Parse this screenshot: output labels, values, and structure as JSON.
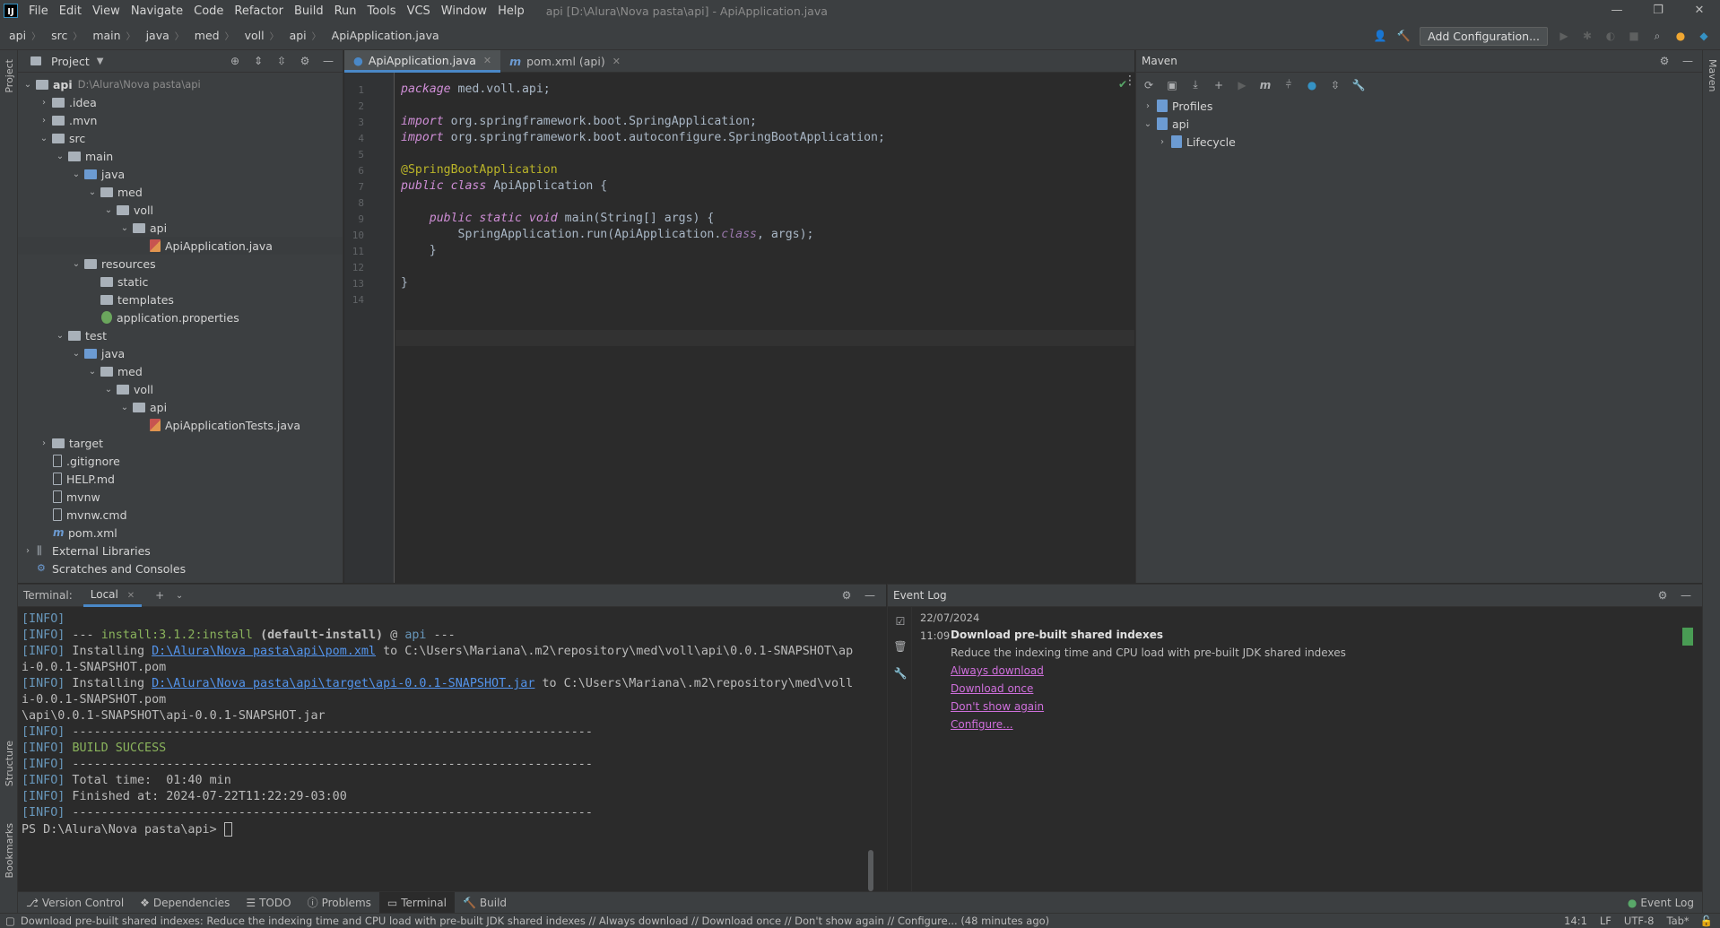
{
  "window": {
    "title": "api [D:\\Alura\\Nova pasta\\api] - ApiApplication.java",
    "controls": [
      "—",
      "❐",
      "✕"
    ]
  },
  "menu": [
    "File",
    "Edit",
    "View",
    "Navigate",
    "Code",
    "Refactor",
    "Build",
    "Run",
    "Tools",
    "VCS",
    "Window",
    "Help"
  ],
  "breadcrumb": [
    "api",
    "src",
    "main",
    "java",
    "med",
    "voll",
    "api",
    "ApiApplication.java"
  ],
  "navbar": {
    "add_config": "Add Configuration..."
  },
  "project": {
    "title": "Project",
    "tree": [
      {
        "depth": 0,
        "arrow": "v",
        "icon": "folder",
        "label": "api",
        "path": "D:\\Alura\\Nova pasta\\api",
        "bold": true
      },
      {
        "depth": 1,
        "arrow": ">",
        "icon": "folder",
        "label": ".idea"
      },
      {
        "depth": 1,
        "arrow": ">",
        "icon": "folder",
        "label": ".mvn"
      },
      {
        "depth": 1,
        "arrow": "v",
        "icon": "folder",
        "label": "src"
      },
      {
        "depth": 2,
        "arrow": "v",
        "icon": "folder",
        "label": "main"
      },
      {
        "depth": 3,
        "arrow": "v",
        "icon": "folder-blue",
        "label": "java"
      },
      {
        "depth": 4,
        "arrow": "v",
        "icon": "folder",
        "label": "med"
      },
      {
        "depth": 5,
        "arrow": "v",
        "icon": "folder",
        "label": "voll"
      },
      {
        "depth": 6,
        "arrow": "v",
        "icon": "folder",
        "label": "api"
      },
      {
        "depth": 7,
        "arrow": "",
        "icon": "java-file",
        "label": "ApiApplication.java",
        "selected": true
      },
      {
        "depth": 3,
        "arrow": "v",
        "icon": "folder",
        "label": "resources"
      },
      {
        "depth": 4,
        "arrow": "",
        "icon": "folder",
        "label": "static"
      },
      {
        "depth": 4,
        "arrow": "",
        "icon": "folder",
        "label": "templates"
      },
      {
        "depth": 4,
        "arrow": "",
        "icon": "properties-file",
        "label": "application.properties"
      },
      {
        "depth": 2,
        "arrow": "v",
        "icon": "folder",
        "label": "test"
      },
      {
        "depth": 3,
        "arrow": "v",
        "icon": "folder-blue",
        "label": "java"
      },
      {
        "depth": 4,
        "arrow": "v",
        "icon": "folder",
        "label": "med"
      },
      {
        "depth": 5,
        "arrow": "v",
        "icon": "folder",
        "label": "voll"
      },
      {
        "depth": 6,
        "arrow": "v",
        "icon": "folder",
        "label": "api"
      },
      {
        "depth": 7,
        "arrow": "",
        "icon": "java-file",
        "label": "ApiApplicationTests.java"
      },
      {
        "depth": 1,
        "arrow": ">",
        "icon": "folder",
        "label": "target"
      },
      {
        "depth": 1,
        "arrow": "",
        "icon": "text-file",
        "label": ".gitignore"
      },
      {
        "depth": 1,
        "arrow": "",
        "icon": "text-file",
        "label": "HELP.md"
      },
      {
        "depth": 1,
        "arrow": "",
        "icon": "text-file",
        "label": "mvnw"
      },
      {
        "depth": 1,
        "arrow": "",
        "icon": "text-file",
        "label": "mvnw.cmd"
      },
      {
        "depth": 1,
        "arrow": "",
        "icon": "maven-file",
        "label": "pom.xml"
      },
      {
        "depth": 0,
        "arrow": ">",
        "icon": "library",
        "label": "External Libraries"
      },
      {
        "depth": 0,
        "arrow": "",
        "icon": "scratch",
        "label": "Scratches and Consoles"
      }
    ]
  },
  "editor": {
    "tabs": [
      {
        "label": "ApiApplication.java",
        "active": true
      },
      {
        "label": "pom.xml (api)",
        "active": false
      }
    ],
    "lines": [
      [
        [
          "kwp",
          "package "
        ],
        [
          "t",
          "med.voll.api;"
        ]
      ],
      [],
      [
        [
          "kwp",
          "import "
        ],
        [
          "t",
          "org.springframework.boot.SpringApplication;"
        ]
      ],
      [
        [
          "kwp",
          "import "
        ],
        [
          "t",
          "org.springframework.boot.autoconfigure.SpringBootApplication;"
        ]
      ],
      [],
      [
        [
          "ann",
          "@SpringBootApplication"
        ]
      ],
      [
        [
          "kwp",
          "public class "
        ],
        [
          "t",
          "ApiApplication {"
        ]
      ],
      [],
      [
        [
          "t",
          "    "
        ],
        [
          "kwp",
          "public static void "
        ],
        [
          "t",
          "main(String[] args) {"
        ]
      ],
      [
        [
          "t",
          "        SpringApplication.run(ApiApplication."
        ],
        [
          "cls",
          "class"
        ],
        [
          "t",
          ", args);"
        ]
      ],
      [
        [
          "t",
          "    }"
        ]
      ],
      [],
      [
        [
          "t",
          "}"
        ]
      ],
      []
    ]
  },
  "maven": {
    "title": "Maven",
    "items": [
      {
        "depth": 0,
        "arrow": ">",
        "label": "Profiles"
      },
      {
        "depth": 0,
        "arrow": "v",
        "label": "api"
      },
      {
        "depth": 1,
        "arrow": ">",
        "label": "Lifecycle"
      }
    ]
  },
  "terminal": {
    "label": "Terminal:",
    "tab": "Local",
    "lines": [
      [
        [
          "tag",
          "[INFO]"
        ]
      ],
      [
        [
          "tag",
          "[INFO]"
        ],
        [
          "t",
          " --- "
        ],
        [
          "green",
          "install:3.1.2:install"
        ],
        [
          "t",
          " "
        ],
        [
          "b",
          "(default-install)"
        ],
        [
          "t",
          " @ "
        ],
        [
          "tag",
          "api"
        ],
        [
          "t",
          " ---"
        ]
      ],
      [
        [
          "tag",
          "[INFO]"
        ],
        [
          "t",
          " Installing "
        ],
        [
          "link",
          "D:\\Alura\\Nova pasta\\api\\pom.xml"
        ],
        [
          "t",
          " to C:\\Users\\Mariana\\.m2\\repository\\med\\voll\\api\\0.0.1-SNAPSHOT\\ap"
        ]
      ],
      [
        [
          "t",
          "i-0.0.1-SNAPSHOT.pom"
        ]
      ],
      [
        [
          "tag",
          "[INFO]"
        ],
        [
          "t",
          " Installing "
        ],
        [
          "link",
          "D:\\Alura\\Nova pasta\\api\\target\\api-0.0.1-SNAPSHOT.jar"
        ],
        [
          "t",
          " to C:\\Users\\Mariana\\.m2\\repository\\med\\voll"
        ]
      ],
      [
        [
          "t",
          "i-0.0.1-SNAPSHOT.pom"
        ]
      ],
      [
        [
          "t",
          "\\api\\0.0.1-SNAPSHOT\\api-0.0.1-SNAPSHOT.jar"
        ]
      ],
      [
        [
          "tag",
          "[INFO]"
        ],
        [
          "t",
          " ------------------------------------------------------------------------"
        ]
      ],
      [
        [
          "tag",
          "[INFO]"
        ],
        [
          "t",
          " "
        ],
        [
          "green",
          "BUILD SUCCESS"
        ]
      ],
      [
        [
          "tag",
          "[INFO]"
        ],
        [
          "t",
          " ------------------------------------------------------------------------"
        ]
      ],
      [
        [
          "tag",
          "[INFO]"
        ],
        [
          "t",
          " Total time:  01:40 min"
        ]
      ],
      [
        [
          "tag",
          "[INFO]"
        ],
        [
          "t",
          " Finished at: 2024-07-22T11:22:29-03:00"
        ]
      ],
      [
        [
          "tag",
          "[INFO]"
        ],
        [
          "t",
          " ------------------------------------------------------------------------"
        ]
      ],
      [
        [
          "t",
          "PS D:\\Alura\\Nova pasta\\api> "
        ]
      ]
    ]
  },
  "event_log": {
    "title": "Event Log",
    "date": "22/07/2024",
    "time": "11:09",
    "heading": "Download pre-built shared indexes",
    "body": "Reduce the indexing time and CPU load with pre-built JDK shared indexes",
    "links": [
      "Always download",
      "Download once",
      "Don't show again",
      "Configure..."
    ]
  },
  "toolwindows": [
    "Version Control",
    "Dependencies",
    "TODO",
    "Problems",
    "Terminal",
    "Build"
  ],
  "toolwindows_right": "Event Log",
  "side_labels": {
    "project": "Project",
    "structure": "Structure",
    "bookmarks": "Bookmarks",
    "maven": "Maven"
  },
  "status": {
    "message": "Download pre-built shared indexes: Reduce the indexing time and CPU load with pre-built JDK shared indexes // Always download // Download once // Don't show again // Configure... (48 minutes ago)",
    "position": "14:1",
    "line_sep": "LF",
    "encoding": "UTF-8",
    "indent": "Tab*"
  },
  "colors": {
    "accent": "#4a88c7",
    "keyword": "#cf8ed6",
    "annotation": "#bbb529",
    "link": "#5394ec",
    "success": "#8ab35c",
    "eventlink": "#cf6fdc"
  }
}
